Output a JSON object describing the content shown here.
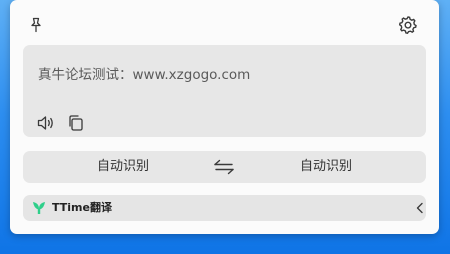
{
  "main": {
    "source_text": "真牛论坛测试：www.xzgogo.com"
  },
  "toolbar": {
    "icons": [
      "pin-icon",
      "gear-icon",
      "speaker-icon",
      "copy-icon"
    ]
  },
  "language_bar": {
    "source_language": "自动识别",
    "target_language": "自动识别",
    "swap_icon": "swap-arrows-icon"
  },
  "footer": {
    "app_name": "TTime翻译",
    "logo_icon": "ttime-logo-icon",
    "collapse_icon": "chevron-left-icon"
  },
  "colors": {
    "desktop_background": "#2d8ef0",
    "window_background": "#fbfbfb",
    "panel_background": "#e7e7e7",
    "logo_green": "#2ecf8a"
  }
}
